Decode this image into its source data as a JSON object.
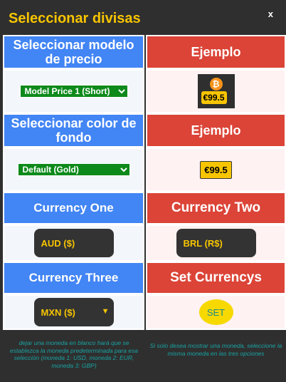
{
  "modal": {
    "title": "Seleccionar divisas",
    "close_label": "x"
  },
  "price_model": {
    "header": "Seleccionar modelo de precio",
    "example_header": "Ejemplo",
    "selected": "Model Price 1 (Short)",
    "example_icon": "bitcoin-icon",
    "example_price": "€99.5"
  },
  "bg_color": {
    "header": "Seleccionar color de fondo",
    "example_header": "Ejemplo",
    "selected": "Default (Gold)",
    "example_price": "€99.5"
  },
  "currencies": {
    "one_header": "Currency One",
    "two_header": "Currency Two",
    "three_header": "Currency Three",
    "set_header": "Set Currencys",
    "one_value": "AUD ($)",
    "two_value": "BRL (R$)",
    "three_value": "MXN ($)",
    "set_label": "SET"
  },
  "notes": {
    "left": "dejar una moneda en blanco hará que se establezca la moneda predeterminada para esa selección (moneda 1: USD, moneda 2: EUR, moneda 3: GBP)",
    "right": "Si solo desea mostrar una moneda, seleccione la misma moneda en las tres opciones"
  },
  "colors": {
    "accent": "#f7c500",
    "blue": "#4285f4",
    "red": "#db4437",
    "green_select": "#0e8a1b",
    "teal_text": "#1aa3a3"
  }
}
